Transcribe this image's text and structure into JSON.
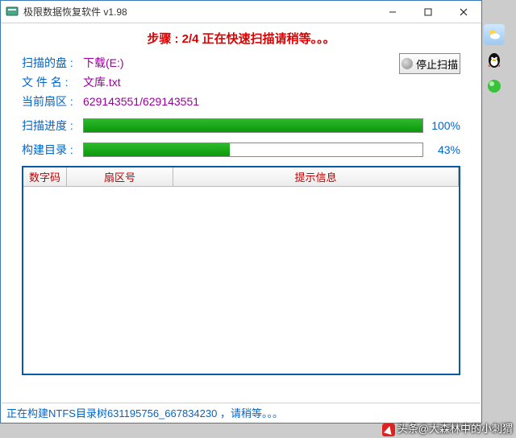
{
  "titlebar": {
    "title": "极限数据恢复软件 v1.98"
  },
  "step_banner": "步骤 : 2/4 正在快速扫描请稍等。。。",
  "info": {
    "disk_label": "扫描的盘 :",
    "disk_value": "下载(E:)",
    "file_label": "文 件 名 :",
    "file_value": "文库.txt",
    "sector_label": "当前扇区 :",
    "sector_value": "629143551/629143551"
  },
  "stop_button": "停止扫描",
  "progress": {
    "scan_label": "扫描进度 :",
    "scan_pct_text": "100%",
    "scan_pct": 100,
    "build_label": "构建目录 :",
    "build_pct_text": "43%",
    "build_pct": 43
  },
  "table": {
    "col1": "数字码",
    "col2": "扇区号",
    "col3": "提示信息"
  },
  "status": "正在构建NTFS目录树631195756_667834230 ，请稍等。。。",
  "watermark": "头条@大森林中的小刺猬"
}
